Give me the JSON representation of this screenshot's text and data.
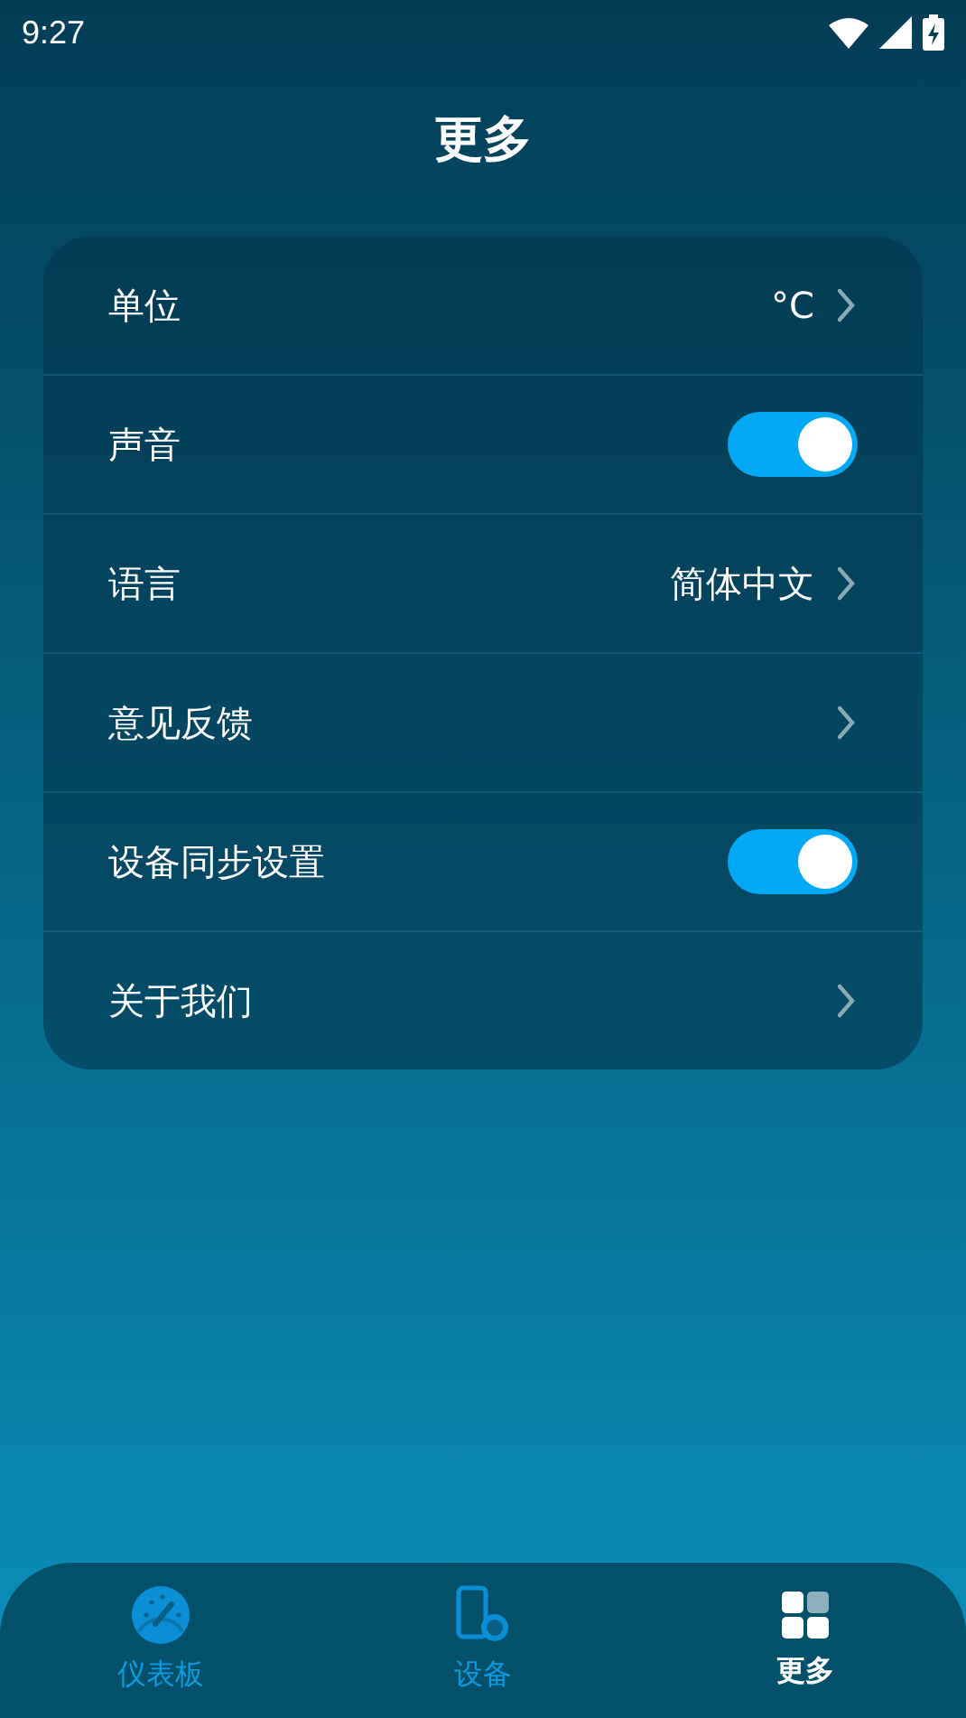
{
  "status_bar": {
    "time": "9:27"
  },
  "title": "更多",
  "settings": [
    {
      "kind": "link",
      "label": "单位",
      "value": "°C"
    },
    {
      "kind": "toggle",
      "label": "声音",
      "on": true
    },
    {
      "kind": "link",
      "label": "语言",
      "value": "简体中文"
    },
    {
      "kind": "link",
      "label": "意见反馈"
    },
    {
      "kind": "toggle",
      "label": "设备同步设置",
      "on": true
    },
    {
      "kind": "link",
      "label": "关于我们"
    }
  ],
  "nav": [
    {
      "kind": "dashboard",
      "label": "仪表板",
      "selected": false
    },
    {
      "kind": "device",
      "label": "设备",
      "selected": false
    },
    {
      "kind": "more",
      "label": "更多",
      "selected": true
    }
  ]
}
